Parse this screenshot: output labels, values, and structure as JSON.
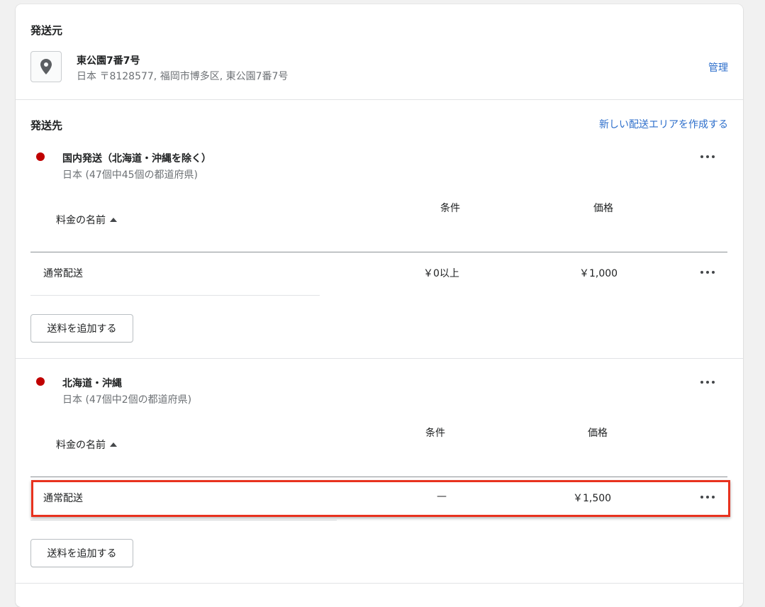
{
  "origin": {
    "heading": "発送元",
    "name": "東公園7番7号",
    "address": "日本 〒8128577, 福岡市博多区, 東公園7番7号",
    "manage_link": "管理"
  },
  "destinations": {
    "heading": "発送先",
    "create_zone_link": "新しい配送エリアを作成する"
  },
  "zones": [
    {
      "name": "国内発送（北海道・沖縄を除く）",
      "detail": "日本 (47個中45個の都道府県)",
      "col_name": "料金の名前",
      "col_condition": "条件",
      "col_price": "価格",
      "rate_name": "通常配送",
      "rate_condition": "￥0以上",
      "rate_price": "￥1,000",
      "add_button": "送料を追加する"
    },
    {
      "name": "北海道・沖縄",
      "detail": "日本 (47個中2個の都道府県)",
      "col_name": "料金の名前",
      "col_condition": "条件",
      "col_price": "価格",
      "rate_name": "通常配送",
      "rate_condition": "—",
      "rate_price": "￥1,500",
      "add_button": "送料を追加する"
    }
  ],
  "colors": {
    "zone_dot": "#c00000",
    "link": "#2c6ecb",
    "highlight": "#e8321f"
  },
  "icons": {
    "location": "location-pin-icon",
    "more": "more-horizontal-icon",
    "sort": "caret-up-icon"
  }
}
